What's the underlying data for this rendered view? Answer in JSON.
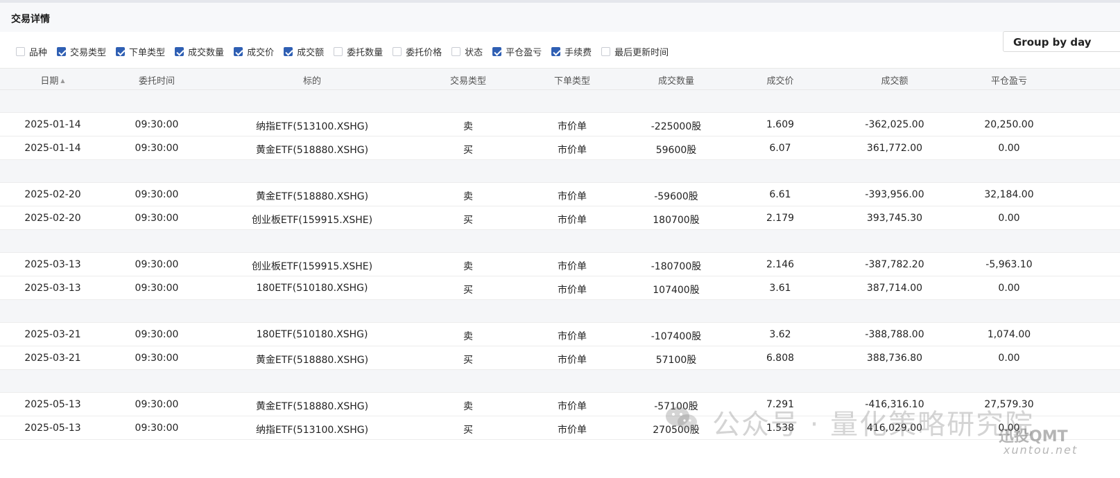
{
  "panel": {
    "title": "交易详情"
  },
  "filters": [
    {
      "label": "品种",
      "checked": false
    },
    {
      "label": "交易类型",
      "checked": true
    },
    {
      "label": "下单类型",
      "checked": true
    },
    {
      "label": "成交数量",
      "checked": true
    },
    {
      "label": "成交价",
      "checked": true
    },
    {
      "label": "成交额",
      "checked": true
    },
    {
      "label": "委托数量",
      "checked": false
    },
    {
      "label": "委托价格",
      "checked": false
    },
    {
      "label": "状态",
      "checked": false
    },
    {
      "label": "平仓盈亏",
      "checked": true
    },
    {
      "label": "手续费",
      "checked": true
    },
    {
      "label": "最后更新时间",
      "checked": false
    }
  ],
  "group_button": {
    "label": "Group by day"
  },
  "columns": [
    "日期",
    "委托时间",
    "标的",
    "交易类型",
    "下单类型",
    "成交数量",
    "成交价",
    "成交额",
    "平仓盈亏"
  ],
  "groups": [
    {
      "rows": [
        [
          "2025-01-14",
          "09:30:00",
          "纳指ETF(513100.XSHG)",
          "卖",
          "市价单",
          "-225000股",
          "1.609",
          "-362,025.00",
          "20,250.00"
        ],
        [
          "2025-01-14",
          "09:30:00",
          "黄金ETF(518880.XSHG)",
          "买",
          "市价单",
          "59600股",
          "6.07",
          "361,772.00",
          "0.00"
        ]
      ]
    },
    {
      "rows": [
        [
          "2025-02-20",
          "09:30:00",
          "黄金ETF(518880.XSHG)",
          "卖",
          "市价单",
          "-59600股",
          "6.61",
          "-393,956.00",
          "32,184.00"
        ],
        [
          "2025-02-20",
          "09:30:00",
          "创业板ETF(159915.XSHE)",
          "买",
          "市价单",
          "180700股",
          "2.179",
          "393,745.30",
          "0.00"
        ]
      ]
    },
    {
      "rows": [
        [
          "2025-03-13",
          "09:30:00",
          "创业板ETF(159915.XSHE)",
          "卖",
          "市价单",
          "-180700股",
          "2.146",
          "-387,782.20",
          "-5,963.10"
        ],
        [
          "2025-03-13",
          "09:30:00",
          "180ETF(510180.XSHG)",
          "买",
          "市价单",
          "107400股",
          "3.61",
          "387,714.00",
          "0.00"
        ]
      ]
    },
    {
      "rows": [
        [
          "2025-03-21",
          "09:30:00",
          "180ETF(510180.XSHG)",
          "卖",
          "市价单",
          "-107400股",
          "3.62",
          "-388,788.00",
          "1,074.00"
        ],
        [
          "2025-03-21",
          "09:30:00",
          "黄金ETF(518880.XSHG)",
          "买",
          "市价单",
          "57100股",
          "6.808",
          "388,736.80",
          "0.00"
        ]
      ]
    },
    {
      "rows": [
        [
          "2025-05-13",
          "09:30:00",
          "黄金ETF(518880.XSHG)",
          "卖",
          "市价单",
          "-57100股",
          "7.291",
          "-416,316.10",
          "27,579.30"
        ],
        [
          "2025-05-13",
          "09:30:00",
          "纳指ETF(513100.XSHG)",
          "买",
          "市价单",
          "270500股",
          "1.538",
          "416,029.00",
          "0.00"
        ]
      ]
    }
  ],
  "watermark": {
    "text": "公众号 · 量化策略研究院",
    "brand": "迅投QMT",
    "url": "xuntou.net"
  },
  "colors": {
    "accent": "#2f5fb3",
    "header_bg": "#f5f6f8",
    "separator_bg": "#f5f6f8"
  }
}
